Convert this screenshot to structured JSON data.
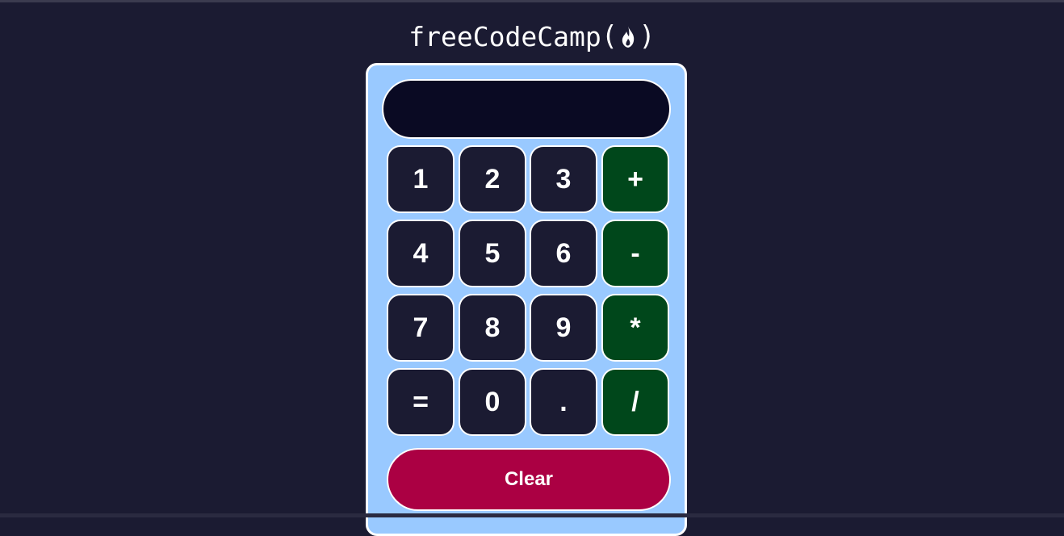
{
  "header": {
    "brand_text": "freeCodeCamp",
    "paren_open": "(",
    "paren_close": ")",
    "logo_icon": "flame-icon"
  },
  "calculator": {
    "display_value": "",
    "keys": [
      {
        "label": "1",
        "kind": "digit"
      },
      {
        "label": "2",
        "kind": "digit"
      },
      {
        "label": "3",
        "kind": "digit"
      },
      {
        "label": "+",
        "kind": "operator"
      },
      {
        "label": "4",
        "kind": "digit"
      },
      {
        "label": "5",
        "kind": "digit"
      },
      {
        "label": "6",
        "kind": "digit"
      },
      {
        "label": "-",
        "kind": "operator"
      },
      {
        "label": "7",
        "kind": "digit"
      },
      {
        "label": "8",
        "kind": "digit"
      },
      {
        "label": "9",
        "kind": "digit"
      },
      {
        "label": "*",
        "kind": "operator"
      },
      {
        "label": "=",
        "kind": "equals"
      },
      {
        "label": "0",
        "kind": "digit"
      },
      {
        "label": ".",
        "kind": "decimal"
      },
      {
        "label": "/",
        "kind": "operator"
      }
    ],
    "clear_label": "Clear"
  },
  "colors": {
    "page_background": "#1b1b32",
    "calculator_body": "#99c9ff",
    "display_background": "#0a0a23",
    "key_background": "#1b1b32",
    "operator_background": "#00471b",
    "clear_background": "#ab0043",
    "border": "#ffffff"
  }
}
